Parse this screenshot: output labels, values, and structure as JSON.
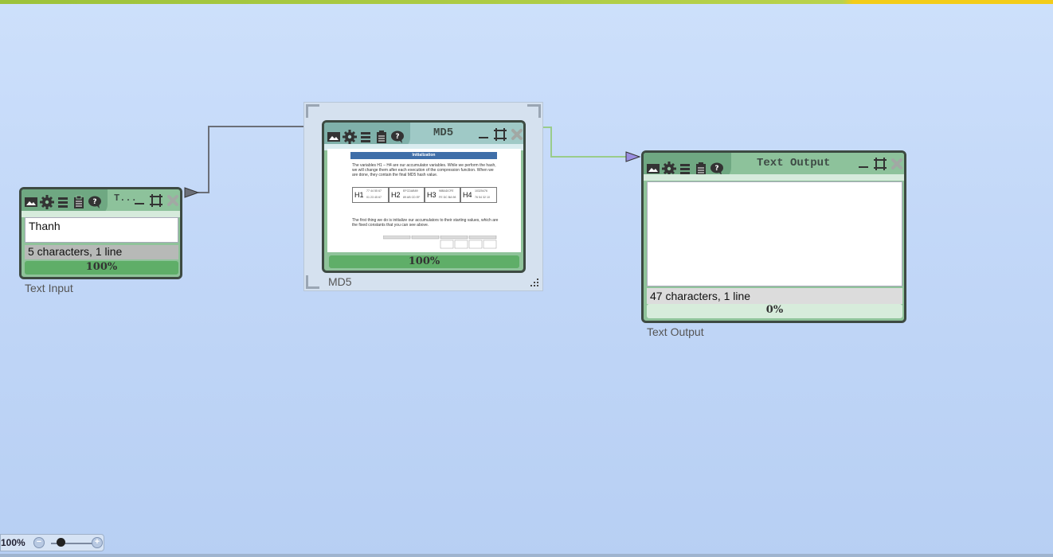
{
  "app": {
    "top_bar_text": "...",
    "zoom": {
      "level": "100%",
      "minus": "−",
      "plus": "+",
      "slider_fraction": 0.25
    }
  },
  "components": {
    "text_input": {
      "title": "T...",
      "content": "Thanh",
      "status": "5 characters,  1 line",
      "progress": "100%",
      "caption": "Text Input"
    },
    "md5": {
      "title": "MD5",
      "progress": "100%",
      "caption": "MD5",
      "preview": {
        "heading": "Initialization",
        "para1": "The variables H1 – H4 are our accumulator variables. While we perform the hash, we will change them after each execution of the compression function. When we are done, they contain the final MD5 hash value.",
        "registers": [
          {
            "label": "H1",
            "hex": "77 44 55 67",
            "bytes": "01 23 45 67"
          },
          {
            "label": "H2",
            "hex": "EFCDAB89",
            "bytes": "89 AB CD EF"
          },
          {
            "label": "H3",
            "hex": "98BADCFE",
            "bytes": "FE DC BA 98"
          },
          {
            "label": "H4",
            "hex": "10325476",
            "bytes": "76 54 32 10"
          }
        ],
        "para2": "The first thing we do is initialize our accumulators to their starting values, which are the fixed constants that you can see above."
      }
    },
    "text_output": {
      "title": "Text Output",
      "content": "",
      "status": "47 characters,  1 line",
      "progress": "0%",
      "caption": "Text Output"
    }
  },
  "colors": {
    "canvas_top": "#cde0fb",
    "component_body": "#8fc39a",
    "component_border": "#3d4a42",
    "progress_fill": "#5fae68",
    "connector_out": "#9acc8a",
    "connector_in_purple": "#9a8ee0"
  },
  "icons": [
    "image-icon",
    "gear-icon",
    "menu-icon",
    "clipboard-icon",
    "help-bubble-icon",
    "minimize-icon",
    "maximize-icon",
    "close-icon"
  ]
}
